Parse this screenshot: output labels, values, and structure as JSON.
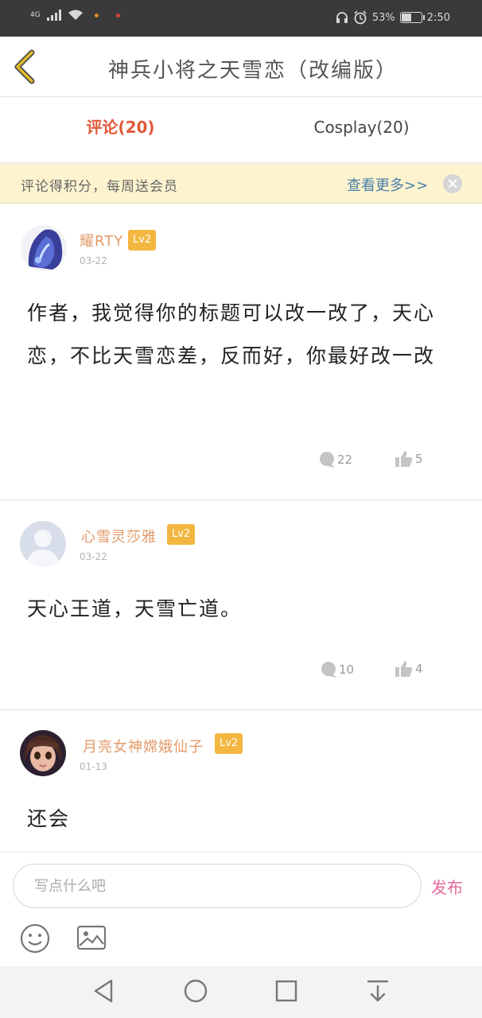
{
  "status": {
    "network": "4G",
    "battery_percent": "53%",
    "battery_level": 0.53,
    "time": "2:50"
  },
  "header": {
    "title": "神兵小将之天雪恋（改编版）"
  },
  "tabs": [
    {
      "label": "评论(20)",
      "active": true
    },
    {
      "label": "Cosplay(20)",
      "active": false
    }
  ],
  "notice": {
    "text": "评论得积分，每周送会员",
    "more": "查看更多>>"
  },
  "comments": [
    {
      "username": "耀RTY",
      "level": "Lv2",
      "date": "03-22",
      "content": "作者，我觉得你的标题可以改一改了，天心恋，不比天雪恋差，反而好，你最好改一改",
      "replies": "22",
      "likes": "5"
    },
    {
      "username": "心雪灵莎雅",
      "level": "Lv2",
      "date": "03-22",
      "content": "天心王道，天雪亡道。",
      "replies": "10",
      "likes": "4"
    },
    {
      "username": "月亮女神嫦娥仙子",
      "level": "Lv2",
      "date": "01-13",
      "content": "还会"
    }
  ],
  "composer": {
    "placeholder": "写点什么吧",
    "publish_label": "发布"
  },
  "colors": {
    "accent": "#e05a3a",
    "username": "#e39b6a",
    "level_badge": "#f3b640",
    "notice_bg": "#fdf4cf",
    "link": "#4a7fa8",
    "publish": "#e06a9a",
    "back_arrow": "#e2b92a"
  }
}
